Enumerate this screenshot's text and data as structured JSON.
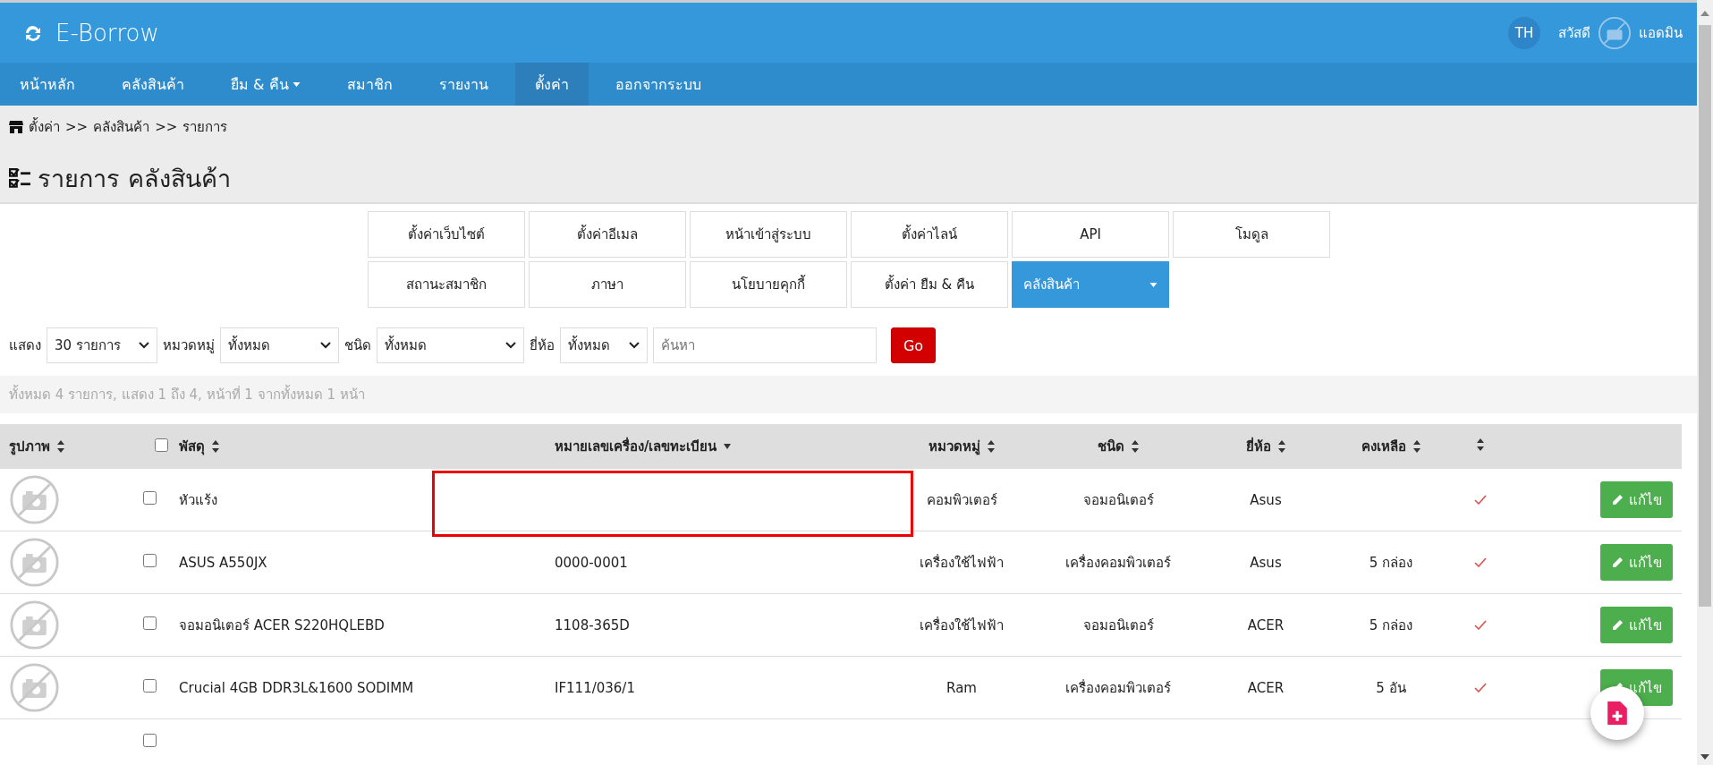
{
  "header": {
    "title": "E-Borrow",
    "language": "TH",
    "greeting": "สวัสดี",
    "user": "แอดมิน"
  },
  "nav": [
    {
      "label": "หน้าหลัก",
      "selected": false,
      "dropdown": false
    },
    {
      "label": "คลังสินค้า",
      "selected": false,
      "dropdown": false
    },
    {
      "label": "ยืม & คืน",
      "selected": false,
      "dropdown": true
    },
    {
      "label": "สมาชิก",
      "selected": false,
      "dropdown": false
    },
    {
      "label": "รายงาน",
      "selected": false,
      "dropdown": false
    },
    {
      "label": "ตั้งค่า",
      "selected": true,
      "dropdown": false
    },
    {
      "label": "ออกจากระบบ",
      "selected": false,
      "dropdown": false
    }
  ],
  "breadcrumb": {
    "separator": ">>",
    "items": [
      "ตั้งค่า",
      "คลังสินค้า",
      "รายการ"
    ]
  },
  "page_title": "รายการ คลังสินค้า",
  "settings_menu": [
    {
      "label": "ตั้งค่าเว็บไซต์",
      "selected": false,
      "dropdown": false
    },
    {
      "label": "ตั้งค่าอีเมล",
      "selected": false,
      "dropdown": false
    },
    {
      "label": "หน้าเข้าสู่ระบบ",
      "selected": false,
      "dropdown": false
    },
    {
      "label": "ตั้งค่าไลน์",
      "selected": false,
      "dropdown": false
    },
    {
      "label": "API",
      "selected": false,
      "dropdown": false
    },
    {
      "label": "โมดูล",
      "selected": false,
      "dropdown": false
    },
    {
      "label": "สถานะสมาชิก",
      "selected": false,
      "dropdown": false
    },
    {
      "label": "ภาษา",
      "selected": false,
      "dropdown": false
    },
    {
      "label": "นโยบายคุกกี้",
      "selected": false,
      "dropdown": false
    },
    {
      "label": "ตั้งค่า ยืม & คืน",
      "selected": false,
      "dropdown": false
    },
    {
      "label": "คลังสินค้า",
      "selected": true,
      "dropdown": true
    }
  ],
  "filters": [
    {
      "label": "แสดง",
      "value": "30 รายการ"
    },
    {
      "label": "หมวดหมู่",
      "value": "ทั้งหมด"
    },
    {
      "label": "ชนิด",
      "value": "ทั้งหมด"
    },
    {
      "label": "ยี่ห้อ",
      "value": "ทั้งหมด"
    }
  ],
  "search": {
    "placeholder": "ค้นหา"
  },
  "go_button": "Go",
  "summary": "ทั้งหมด 4 รายการ, แสดง 1 ถึง 4, หน้าที่ 1 จากทั้งหมด 1 หน้า",
  "table": {
    "columns": [
      {
        "kind": "text",
        "label": "รูปภาพ",
        "sortable": true,
        "sorted": false
      },
      {
        "kind": "checkbox",
        "checked": false
      },
      {
        "kind": "text",
        "label": "พัสดุ",
        "sortable": true,
        "sorted": false
      },
      {
        "kind": "text",
        "label": "หมายเลขเครื่อง/เลขทะเบียน",
        "sortable": true,
        "sorted": true
      },
      {
        "kind": "text",
        "label": "หมวดหมู่",
        "sortable": true,
        "sorted": false
      },
      {
        "kind": "text",
        "label": "ชนิด",
        "sortable": true,
        "sorted": false
      },
      {
        "kind": "text",
        "label": "ยี่ห้อ",
        "sortable": true,
        "sorted": false
      },
      {
        "kind": "text",
        "label": "คงเหลือ",
        "sortable": true,
        "sorted": false
      },
      {
        "kind": "sort",
        "sortable": true,
        "sorted": false
      },
      {
        "kind": "empty"
      }
    ],
    "rows": [
      {
        "kind": "item",
        "checked": false,
        "name": "หัวแร้ง",
        "category": "คอมพิวเตอร์",
        "type": "จอมอนิเตอร์",
        "brand": "Asus",
        "active": true,
        "edit": "แก้ไข"
      },
      {
        "kind": "item",
        "checked": false,
        "name": "ASUS A550JX",
        "serial": "0000-0001",
        "category": "เครื่องใช้ไฟฟ้า",
        "type": "เครื่องคอมพิวเตอร์",
        "brand": "Asus",
        "remaining": "5 กล่อง",
        "active": true,
        "edit": "แก้ไข"
      },
      {
        "kind": "item",
        "checked": false,
        "name": "จอมอนิเตอร์ ACER S220HQLEBD",
        "serial": "1108-365D",
        "category": "เครื่องใช้ไฟฟ้า",
        "type": "จอมอนิเตอร์",
        "brand": "ACER",
        "remaining": "5 กล่อง",
        "active": true,
        "edit": "แก้ไข"
      },
      {
        "kind": "item",
        "checked": false,
        "name": "Crucial 4GB DDR3L&1600 SODIMM",
        "serial": "IF111/036/1",
        "category": "Ram",
        "type": "เครื่องคอมพิวเตอร์",
        "brand": "ACER",
        "remaining": "5 อัน",
        "active": true,
        "edit": "แก้ไข"
      },
      {
        "kind": "empty",
        "checked": false
      }
    ]
  }
}
